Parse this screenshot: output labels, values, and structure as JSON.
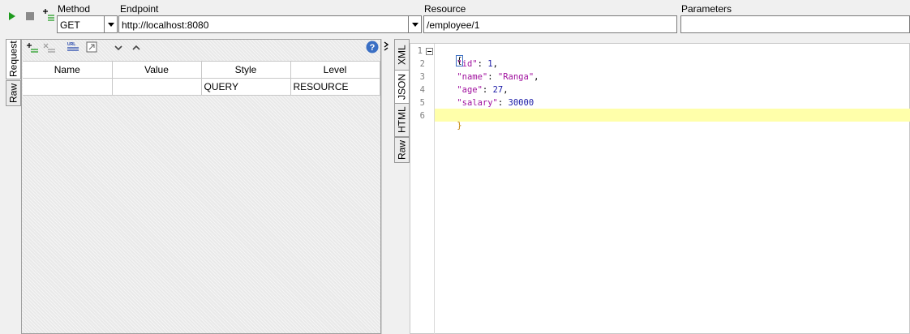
{
  "toolbar": {
    "method_label": "Method",
    "endpoint_label": "Endpoint",
    "resource_label": "Resource",
    "parameters_label": "Parameters",
    "method_value": "GET",
    "endpoint_value": "http://localhost:8080",
    "resource_value": "/employee/1",
    "parameters_value": "",
    "icons": [
      "play-icon",
      "stop-icon",
      "add-endpoint-icon"
    ]
  },
  "request_panel": {
    "side_tabs": [
      {
        "label": "Request",
        "active": true
      },
      {
        "label": "Raw",
        "active": false
      }
    ],
    "toolbar_icons": [
      "add-param-icon",
      "remove-param-icon",
      "url-icon",
      "expand-icon",
      "move-down-icon",
      "move-up-icon",
      "help-icon"
    ],
    "columns": [
      "Name",
      "Value",
      "Style",
      "Level"
    ],
    "rows": [
      {
        "name": "",
        "value": "",
        "style": "QUERY",
        "level": "RESOURCE"
      }
    ]
  },
  "response_panel": {
    "side_tabs": [
      {
        "label": "XML",
        "active": false
      },
      {
        "label": "JSON",
        "active": true
      },
      {
        "label": "HTML",
        "active": false
      },
      {
        "label": "Raw",
        "active": false
      }
    ],
    "lines": [
      {
        "num": "1",
        "text": "{"
      },
      {
        "num": "2",
        "key": "\"id\"",
        "value": "1",
        "trail": ","
      },
      {
        "num": "3",
        "key": "\"name\"",
        "value": "\"Ranga\"",
        "trail": ","
      },
      {
        "num": "4",
        "key": "\"age\"",
        "value": "27",
        "trail": ","
      },
      {
        "num": "5",
        "key": "\"salary\"",
        "value": "30000",
        "trail": ""
      },
      {
        "num": "6",
        "text": "}"
      }
    ],
    "highlight_color": "#ffffaa"
  },
  "colors": {
    "run_green": "#1e9b1e",
    "json_key": "#a0119e",
    "json_number": "#1a1aa6"
  }
}
